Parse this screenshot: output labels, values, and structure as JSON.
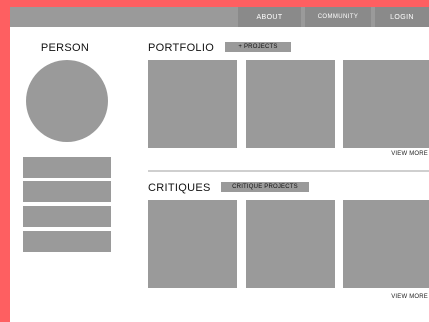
{
  "nav": {
    "about": "ABOUT",
    "community": "COMMUNITY",
    "login": "LOGIN"
  },
  "profile": {
    "label": "PERSON"
  },
  "portfolio": {
    "title": "PORTFOLIO",
    "tag": "+ PROJECTS",
    "view_more": "VIEW MORE"
  },
  "critiques": {
    "title": "CRITIQUES",
    "tag": "CRITIQUE PROJECTS",
    "view_more": "VIEW MORE"
  },
  "colors": {
    "background_accent": "#fe5f61",
    "placeholder_gray": "#9a9a9a",
    "nav_button_gray": "#8a8a8a"
  }
}
